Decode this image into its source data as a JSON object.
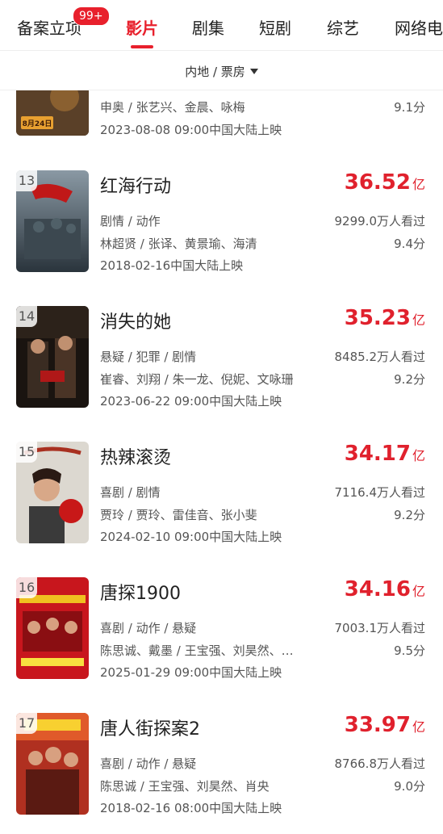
{
  "tabs": [
    {
      "label": "备案立项"
    },
    {
      "label": "影片"
    },
    {
      "label": "剧集"
    },
    {
      "label": "短剧"
    },
    {
      "label": "综艺"
    },
    {
      "label": "网络电"
    }
  ],
  "badge": "99+",
  "filter": {
    "label": "内地 / 票房"
  },
  "partial_item": {
    "cast": "申奥 / 张艺兴、金晨、咏梅",
    "rating": "9.1分",
    "release": "2023-08-08 09:00中国大陆上映",
    "poster_text": "8月24日"
  },
  "movies": [
    {
      "rank": "13",
      "title": "红海行动",
      "box": "36.52",
      "unit": "亿",
      "genre": "剧情 / 动作",
      "views": "9299.0万人看过",
      "cast": "林超贤 / 张译、黄景瑜、海清",
      "rating": "9.4分",
      "release": "2018-02-16中国大陆上映",
      "poster_colors": [
        "#6b7a86",
        "#2f3a42"
      ]
    },
    {
      "rank": "14",
      "title": "消失的她",
      "box": "35.23",
      "unit": "亿",
      "genre": "悬疑 / 犯罪 / 剧情",
      "views": "8485.2万人看过",
      "cast": "崔睿、刘翔 / 朱一龙、倪妮、文咏珊",
      "rating": "9.2分",
      "release": "2023-06-22 09:00中国大陆上映",
      "poster_colors": [
        "#2a2018",
        "#0e0a08"
      ]
    },
    {
      "rank": "15",
      "title": "热辣滚烫",
      "box": "34.17",
      "unit": "亿",
      "genre": "喜剧 / 剧情",
      "views": "7116.4万人看过",
      "cast": "贾玲 / 贾玲、雷佳音、张小斐",
      "rating": "9.2分",
      "release": "2024-02-10 09:00中国大陆上映",
      "poster_colors": [
        "#e8e4dc",
        "#b8c0c4"
      ]
    },
    {
      "rank": "16",
      "title": "唐探1900",
      "box": "34.16",
      "unit": "亿",
      "genre": "喜剧 / 动作 / 悬疑",
      "views": "7003.1万人看过",
      "cast": "陈思诚、戴墨 / 王宝强、刘昊然、…",
      "rating": "9.5分",
      "release": "2025-01-29 09:00中国大陆上映",
      "poster_colors": [
        "#c8161d",
        "#7e0c10"
      ]
    },
    {
      "rank": "17",
      "title": "唐人街探案2",
      "box": "33.97",
      "unit": "亿",
      "genre": "喜剧 / 动作 / 悬疑",
      "views": "8766.8万人看过",
      "cast": "陈思诚 / 王宝强、刘昊然、肖央",
      "rating": "9.0分",
      "release": "2018-02-16 08:00中国大陆上映",
      "poster_colors": [
        "#d8402a",
        "#6a1e14"
      ]
    }
  ]
}
